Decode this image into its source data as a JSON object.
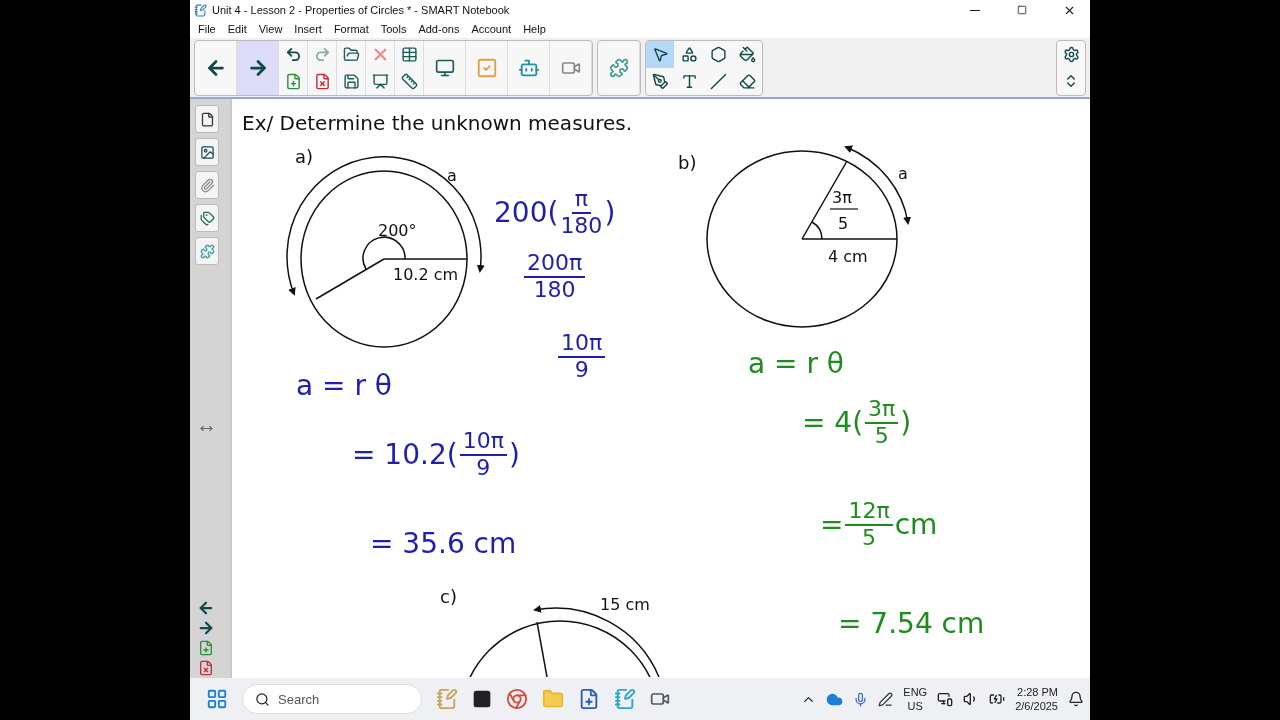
{
  "window": {
    "title": "Unit 4 - Lesson 2 - Properties of Circles * - SMART Notebook"
  },
  "menu": [
    "File",
    "Edit",
    "View",
    "Insert",
    "Format",
    "Tools",
    "Add-ons",
    "Account",
    "Help"
  ],
  "nav": [
    {
      "kind": "back",
      "highlighted": false
    },
    {
      "kind": "forward",
      "highlighted": true
    }
  ],
  "tools": [
    {
      "kind": "select",
      "selected": true
    },
    {
      "kind": "shapes",
      "selected": false
    },
    {
      "kind": "fill-shape",
      "selected": false
    },
    {
      "kind": "fill",
      "selected": false
    },
    {
      "kind": "pens",
      "selected": false
    },
    {
      "kind": "text",
      "selected": false
    },
    {
      "kind": "line",
      "selected": false
    },
    {
      "kind": "eraser",
      "selected": false
    }
  ],
  "page": {
    "heading": "Ex/ Determine the unknown measures.",
    "diagrams": [
      {
        "label": "a)",
        "angle": "200°",
        "radius": "10.2 cm",
        "arc": "a"
      },
      {
        "label": "b)",
        "angle_num": "3π",
        "angle_den": "5",
        "radius": "4 cm",
        "arc": "a"
      },
      {
        "label": "c)",
        "arc": "15 cm"
      }
    ],
    "ink": [
      {
        "color": "#1f1fae",
        "parts": [
          {
            "kind": "text",
            "text": "200("
          },
          {
            "kind": "frac",
            "num": "π",
            "den": "180"
          },
          {
            "kind": "text",
            "text": ")"
          }
        ]
      },
      {
        "color": "#1f1fae",
        "parts": [
          {
            "kind": "frac",
            "num": "200π",
            "den": "180"
          }
        ]
      },
      {
        "color": "#1f1fae",
        "parts": [
          {
            "kind": "frac",
            "num": "10π",
            "den": "9"
          }
        ]
      },
      {
        "color": "#1f1fae",
        "parts": [
          {
            "kind": "text",
            "text": "a = r θ"
          }
        ]
      },
      {
        "color": "#1f1fae",
        "parts": [
          {
            "kind": "text",
            "text": "= 10.2("
          },
          {
            "kind": "frac",
            "num": "10π",
            "den": "9"
          },
          {
            "kind": "text",
            "text": ")"
          }
        ]
      },
      {
        "color": "#1f1fae",
        "parts": [
          {
            "kind": "text",
            "text": "= 35.6 cm"
          }
        ]
      },
      {
        "color": "#1e8c1e",
        "parts": [
          {
            "kind": "text",
            "text": "a = r θ"
          }
        ]
      },
      {
        "color": "#1e8c1e",
        "parts": [
          {
            "kind": "text",
            "text": "= 4("
          },
          {
            "kind": "frac",
            "num": "3π",
            "den": "5"
          },
          {
            "kind": "text",
            "text": ")"
          }
        ]
      },
      {
        "color": "#1e8c1e",
        "parts": [
          {
            "kind": "text",
            "text": "="
          },
          {
            "kind": "frac",
            "num": "12π",
            "den": "5"
          },
          {
            "kind": "text",
            "text": "cm"
          }
        ]
      },
      {
        "color": "#1e8c1e",
        "parts": [
          {
            "kind": "text",
            "text": "= 7.54 cm"
          }
        ]
      }
    ]
  },
  "taskbar": {
    "search_placeholder": "Search",
    "language": "ENG",
    "region": "US",
    "time": "2:28 PM",
    "date": "2/6/2025"
  }
}
